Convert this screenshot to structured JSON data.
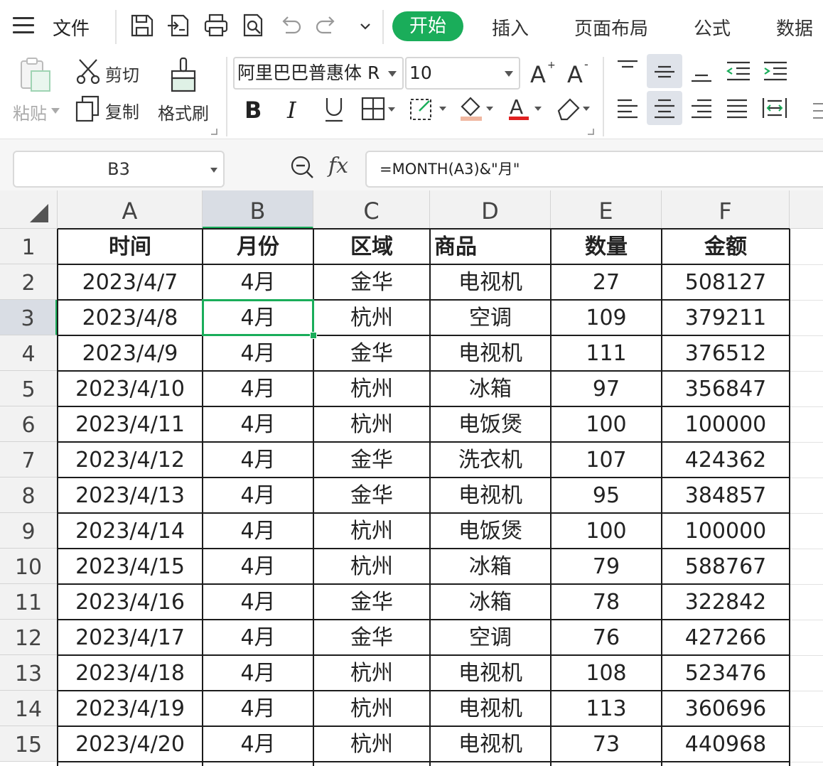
{
  "menu": {
    "file": "文件",
    "tabs": [
      "开始",
      "插入",
      "页面布局",
      "公式",
      "数据"
    ],
    "active_tab": "开始"
  },
  "ribbon": {
    "paste": "粘贴",
    "cut": "剪切",
    "copy": "复制",
    "format_painter": "格式刷",
    "font_name": "阿里巴巴普惠体 R",
    "font_size": "10"
  },
  "formula_bar": {
    "name_box": "B3",
    "fx": "fx",
    "formula": "=MONTH(A3)&\"月\""
  },
  "sheet": {
    "columns": [
      "A",
      "B",
      "C",
      "D",
      "E",
      "F"
    ],
    "selected_column": "B",
    "selected_row": "3",
    "selected_cell": "B3",
    "rows": [
      {
        "n": "1",
        "cells": [
          "时间",
          "月份",
          "区域",
          "商品",
          "数量",
          "金额"
        ]
      },
      {
        "n": "2",
        "cells": [
          "2023/4/7",
          "4月",
          "金华",
          "电视机",
          "27",
          "508127"
        ]
      },
      {
        "n": "3",
        "cells": [
          "2023/4/8",
          "4月",
          "杭州",
          "空调",
          "109",
          "379211"
        ]
      },
      {
        "n": "4",
        "cells": [
          "2023/4/9",
          "4月",
          "金华",
          "电视机",
          "111",
          "376512"
        ]
      },
      {
        "n": "5",
        "cells": [
          "2023/4/10",
          "4月",
          "杭州",
          "冰箱",
          "97",
          "356847"
        ]
      },
      {
        "n": "6",
        "cells": [
          "2023/4/11",
          "4月",
          "杭州",
          "电饭煲",
          "100",
          "100000"
        ]
      },
      {
        "n": "7",
        "cells": [
          "2023/4/12",
          "4月",
          "金华",
          "洗衣机",
          "107",
          "424362"
        ]
      },
      {
        "n": "8",
        "cells": [
          "2023/4/13",
          "4月",
          "金华",
          "电视机",
          "95",
          "384857"
        ]
      },
      {
        "n": "9",
        "cells": [
          "2023/4/14",
          "4月",
          "杭州",
          "电饭煲",
          "100",
          "100000"
        ]
      },
      {
        "n": "10",
        "cells": [
          "2023/4/15",
          "4月",
          "杭州",
          "冰箱",
          "79",
          "588767"
        ]
      },
      {
        "n": "11",
        "cells": [
          "2023/4/16",
          "4月",
          "金华",
          "冰箱",
          "78",
          "322842"
        ]
      },
      {
        "n": "12",
        "cells": [
          "2023/4/17",
          "4月",
          "金华",
          "空调",
          "76",
          "427266"
        ]
      },
      {
        "n": "13",
        "cells": [
          "2023/4/18",
          "4月",
          "杭州",
          "电视机",
          "108",
          "523476"
        ]
      },
      {
        "n": "14",
        "cells": [
          "2023/4/19",
          "4月",
          "杭州",
          "电视机",
          "113",
          "360696"
        ]
      },
      {
        "n": "15",
        "cells": [
          "2023/4/20",
          "4月",
          "杭州",
          "电视机",
          "73",
          "440968"
        ]
      }
    ]
  },
  "colors": {
    "accent": "#1aad5a",
    "header_bg": "#f2f2f2",
    "selected_header_bg": "#d9dde4"
  }
}
